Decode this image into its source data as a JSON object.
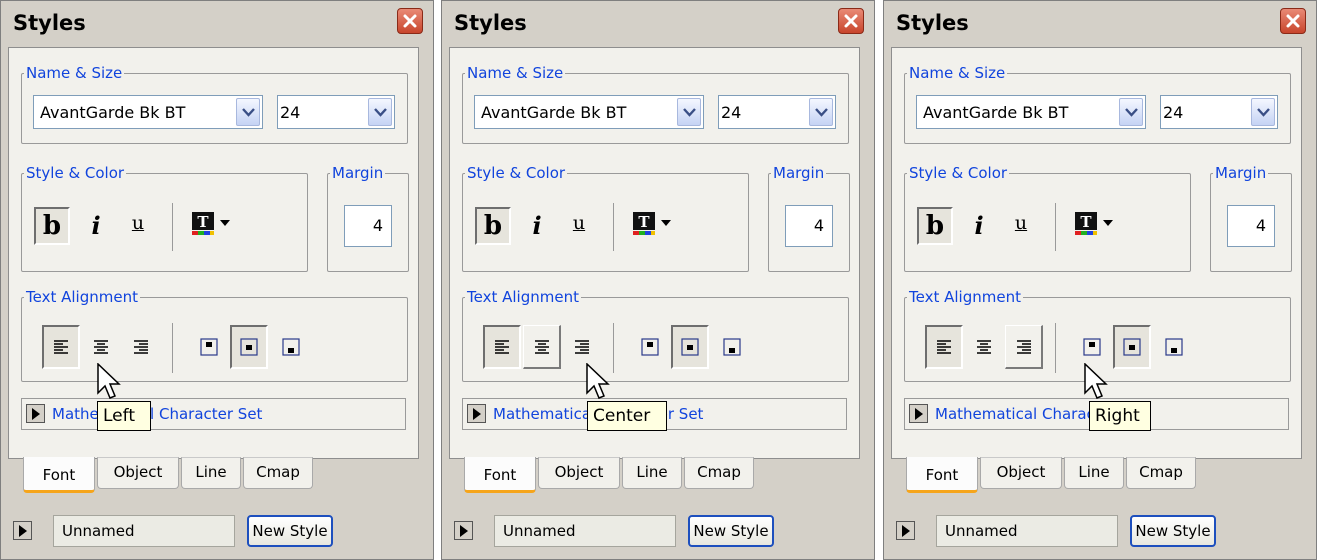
{
  "panels": [
    {
      "title": "Styles",
      "groups": {
        "name_size": "Name & Size",
        "style_color": "Style & Color",
        "margin": "Margin",
        "text_alignment": "Text Alignment"
      },
      "font_name": "AvantGarde Bk BT",
      "font_size": "24",
      "style_buttons": {
        "bold": "b",
        "italic": "i",
        "underline": "u"
      },
      "margin_value": "4",
      "alignment_state": "left-pressed",
      "expander_label": "Mathematical Character Set",
      "tabs": [
        "Font",
        "Object",
        "Line",
        "Cmap"
      ],
      "active_tab": "Font",
      "style_name": "Unnamed",
      "new_style_label": "New Style",
      "tooltip": "Left"
    },
    {
      "title": "Styles",
      "groups": {
        "name_size": "Name & Size",
        "style_color": "Style & Color",
        "margin": "Margin",
        "text_alignment": "Text Alignment"
      },
      "font_name": "AvantGarde Bk BT",
      "font_size": "24",
      "style_buttons": {
        "bold": "b",
        "italic": "i",
        "underline": "u"
      },
      "margin_value": "4",
      "alignment_state": "center-hover",
      "expander_label": "Mathematical Character Set",
      "tabs": [
        "Font",
        "Object",
        "Line",
        "Cmap"
      ],
      "active_tab": "Font",
      "style_name": "Unnamed",
      "new_style_label": "New Style",
      "tooltip": "Center"
    },
    {
      "title": "Styles",
      "groups": {
        "name_size": "Name & Size",
        "style_color": "Style & Color",
        "margin": "Margin",
        "text_alignment": "Text Alignment"
      },
      "font_name": "AvantGarde Bk BT",
      "font_size": "24",
      "style_buttons": {
        "bold": "b",
        "italic": "i",
        "underline": "u"
      },
      "margin_value": "4",
      "alignment_state": "right-hover",
      "expander_label": "Mathematical Character Set",
      "tabs": [
        "Font",
        "Object",
        "Line",
        "Cmap"
      ],
      "active_tab": "Font",
      "style_name": "Unnamed",
      "new_style_label": "New Style",
      "tooltip": "Right"
    }
  ],
  "colors": {
    "panel_bg": "#d4d0c8",
    "content_bg": "#f2f1ec",
    "legend_blue": "#1144dd",
    "active_tab_underline": "#f6a51b",
    "close_red": "#d0502f",
    "tooltip_bg": "#ffffe1"
  },
  "icons": [
    "close-icon",
    "chevron-down-icon",
    "text-color-icon",
    "align-left-icon",
    "align-center-icon",
    "align-right-icon",
    "valign-top-icon",
    "valign-middle-icon",
    "valign-bottom-icon",
    "play-icon",
    "mouse-cursor-icon"
  ]
}
